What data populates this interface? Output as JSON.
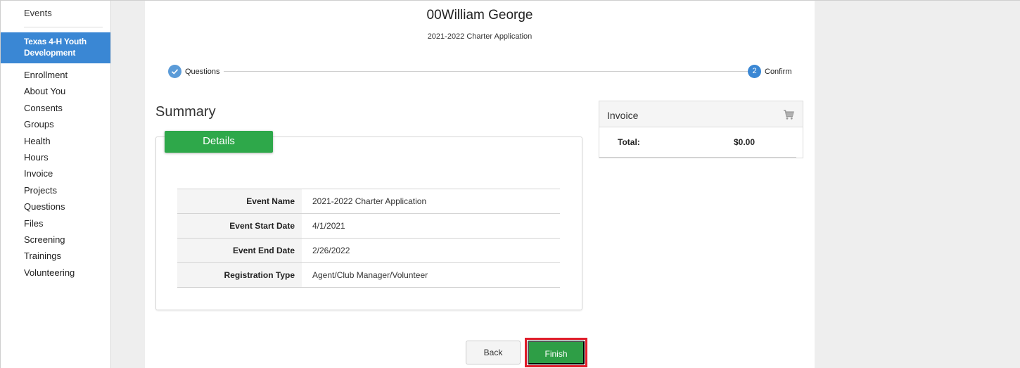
{
  "sidebar": {
    "top_item": "Events",
    "active_item": "Texas 4-H Youth Development",
    "items": [
      "Enrollment",
      "About You",
      "Consents",
      "Groups",
      "Health",
      "Hours",
      "Invoice",
      "Projects",
      "Questions",
      "Files",
      "Screening",
      "Trainings",
      "Volunteering"
    ]
  },
  "header": {
    "name": "00William George",
    "subtitle": "2021-2022 Charter Application"
  },
  "stepper": {
    "step1": {
      "label": "Questions",
      "icon": "check-icon",
      "state": "completed"
    },
    "step2": {
      "number": "2",
      "label": "Confirm",
      "state": "active"
    }
  },
  "summary": {
    "heading": "Summary",
    "details_tab": "Details",
    "rows": [
      {
        "label": "Event Name",
        "value": "2021-2022 Charter Application"
      },
      {
        "label": "Event Start Date",
        "value": "4/1/2021"
      },
      {
        "label": "Event End Date",
        "value": "2/26/2022"
      },
      {
        "label": "Registration Type",
        "value": "Agent/Club Manager/Volunteer"
      }
    ]
  },
  "invoice": {
    "title": "Invoice",
    "icon": "cart-icon",
    "total_label": "Total:",
    "total_value": "$0.00"
  },
  "actions": {
    "back_label": "Back",
    "finish_label": "Finish"
  },
  "colors": {
    "active_sidebar": "#3a87d4",
    "details_tab": "#2ea84a",
    "finish_button": "#2e9e46",
    "highlight_frame": "#e01e2b"
  }
}
